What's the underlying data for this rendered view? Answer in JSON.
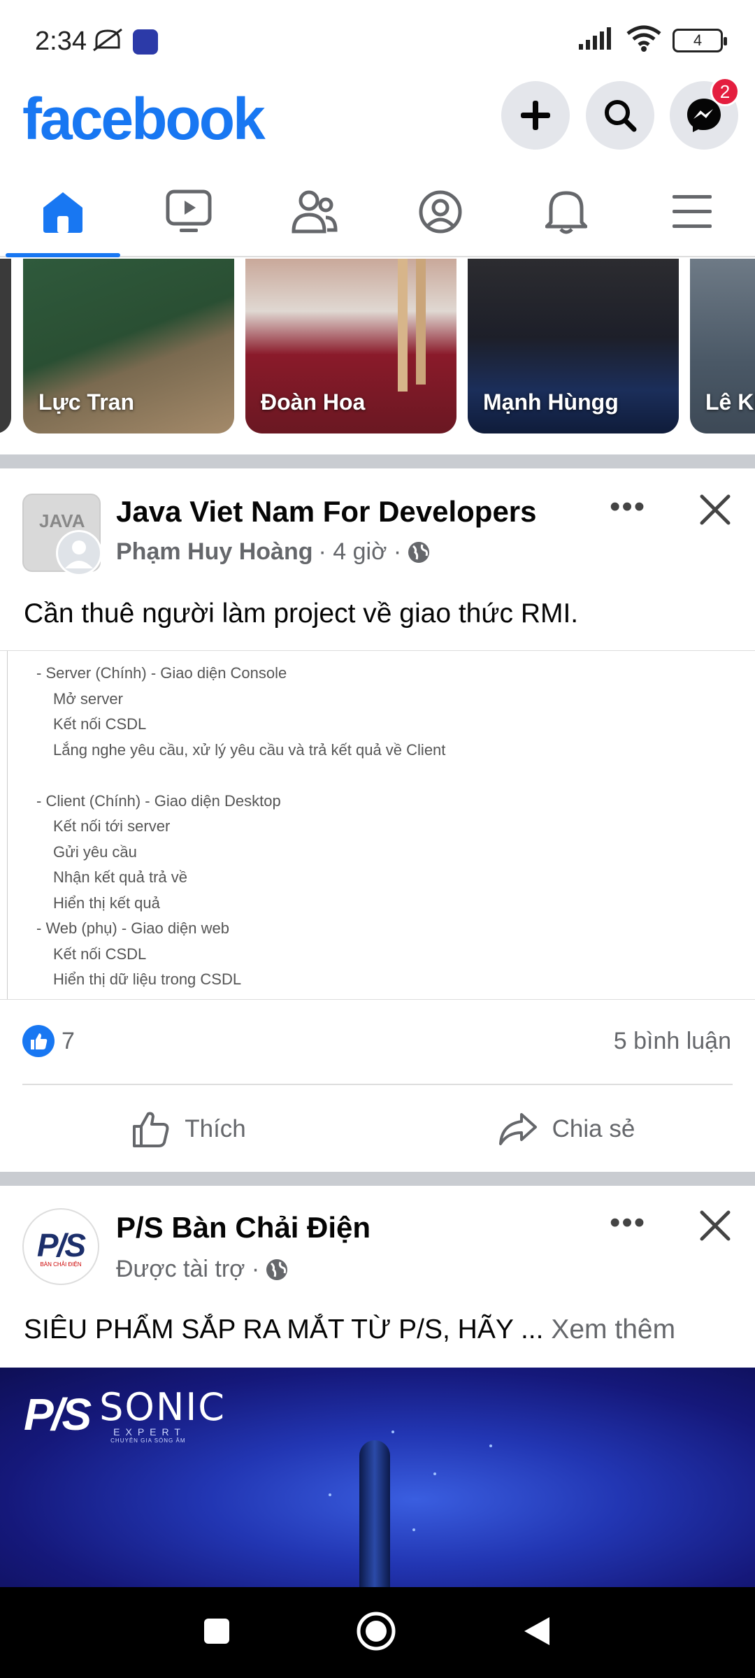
{
  "status_bar": {
    "time": "2:34",
    "battery": "4"
  },
  "header": {
    "logo": "facebook",
    "messenger_badge": "2",
    "brand_color": "#1877f2"
  },
  "tabs": [
    {
      "name": "home",
      "icon": "home-icon",
      "active": true
    },
    {
      "name": "watch",
      "icon": "video-icon",
      "active": false
    },
    {
      "name": "friends",
      "icon": "friends-icon",
      "active": false
    },
    {
      "name": "profile",
      "icon": "profile-icon",
      "active": false
    },
    {
      "name": "notifications",
      "icon": "bell-icon",
      "active": false
    },
    {
      "name": "menu",
      "icon": "hamburger-icon",
      "active": false
    }
  ],
  "stories": [
    {
      "name": "Lực Tran"
    },
    {
      "name": "Đoàn Hoa"
    },
    {
      "name": "Mạnh Hùngg"
    },
    {
      "name": "Lê Kh"
    }
  ],
  "post1": {
    "group_logo_text": "JAVA",
    "group": "Java Viet Nam For Developers",
    "author": "Phạm Huy Hoàng",
    "time": "· 4 giờ ·",
    "text": "Cần thuê người làm project về giao thức RMI.",
    "doc_lines": [
      "- Server (Chính) - Giao diện Console",
      "Mở server",
      "Kết nối CSDL",
      "Lắng nghe yêu cầu, xử lý yêu cầu và trả kết quả về Client",
      "- Client (Chính) - Giao diện Desktop",
      "Kết nối tới server",
      "Gửi yêu cầu",
      "Nhận kết quả trả về",
      "Hiển thị kết quả",
      "- Web (phụ) - Giao diện web",
      "Kết nối CSDL",
      "Hiển thị dữ liệu trong CSDL"
    ],
    "likes": "7",
    "comments": "5 bình luận",
    "like_label": "Thích",
    "share_label": "Chia sẻ"
  },
  "post2": {
    "logo_text": "P/S",
    "logo_sub": "BÀN CHẢI ĐIỆN",
    "page": "P/S Bàn Chải Điện",
    "sponsored": "Được tài trợ ·",
    "text": "SIÊU PHẨM SẮP RA MẮT TỪ P/S, HÃY ...",
    "see_more": "Xem thêm",
    "ad_brand": "P/S",
    "ad_product": "SONIC",
    "ad_product_sub": "EXPERT",
    "ad_tagline": "CHUYÊN GIA SÓNG ÂM"
  }
}
